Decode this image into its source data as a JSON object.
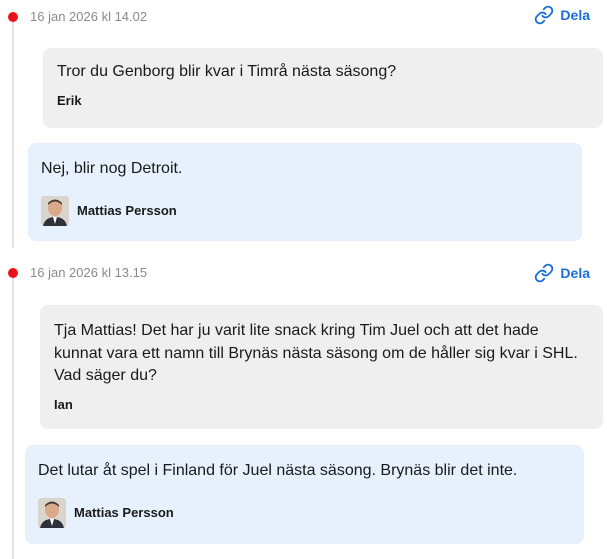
{
  "threads": [
    {
      "timestamp": "16 jan 2026 kl 14.02",
      "share_label": "Dela",
      "question": {
        "text": "Tror du Genborg blir kvar i Timrå nästa säsong?",
        "author": "Erik"
      },
      "answer": {
        "text": "Nej, blir nog Detroit.",
        "author": "Mattias Persson"
      }
    },
    {
      "timestamp": "16 jan 2026 kl 13.15",
      "share_label": "Dela",
      "question": {
        "text": "Tja Mattias! Det har ju varit lite snack kring Tim Juel och att det hade kunnat vara ett namn till Brynäs nästa säsong om de håller sig kvar i SHL. Vad säger du?",
        "author": "Ian"
      },
      "answer": {
        "text": "Det lutar åt spel i Finland för Juel nästa säsong. Brynäs blir det inte.",
        "author": "Mattias Persson"
      }
    }
  ],
  "colors": {
    "accent": "#1a6fd8",
    "dot": "#e8141b",
    "question_bg": "#efefef",
    "answer_bg": "#e6f1fd"
  },
  "icons": {
    "share": "link-icon",
    "avatar": "author-photo"
  }
}
